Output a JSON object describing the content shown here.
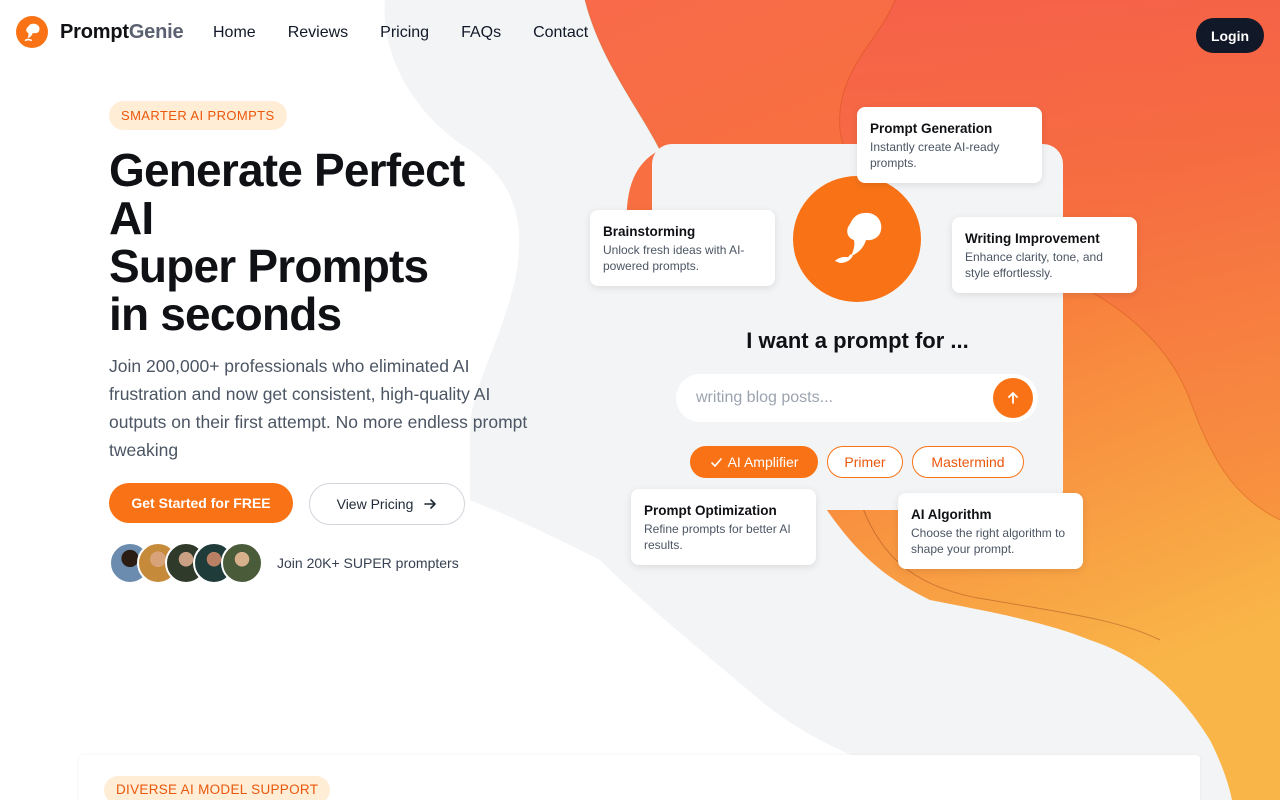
{
  "brand": {
    "name_part1": "Prompt",
    "name_part2": "Genie"
  },
  "nav": {
    "items": [
      "Home",
      "Reviews",
      "Pricing",
      "FAQs",
      "Contact"
    ]
  },
  "login_label": "Login",
  "hero": {
    "eyebrow": "SMARTER AI PROMPTS",
    "headline_lines": [
      "Generate Perfect",
      "AI",
      "Super Prompts",
      "in seconds"
    ],
    "subtitle": "Join 200,000+ professionals who eliminated AI frustration and now get consistent, high-quality AI outputs on their first attempt. No more endless prompt tweaking",
    "cta_primary": "Get Started for FREE",
    "cta_secondary": "View Pricing",
    "social_proof": "Join 20K+ SUPER prompters"
  },
  "prompt_card": {
    "question": "I want a prompt for ...",
    "input_placeholder": "writing blog posts...",
    "modes": [
      {
        "label": "AI Amplifier",
        "active": true
      },
      {
        "label": "Primer",
        "active": false
      },
      {
        "label": "Mastermind",
        "active": false
      }
    ]
  },
  "features": [
    {
      "title": "Prompt Generation",
      "desc": "Instantly create AI-ready prompts."
    },
    {
      "title": "Brainstorming",
      "desc": "Unlock fresh ideas with AI-powered prompts."
    },
    {
      "title": "Writing Improvement",
      "desc": "Enhance clarity, tone, and style effortlessly."
    },
    {
      "title": "Prompt Optimization",
      "desc": "Refine prompts for better AI results."
    },
    {
      "title": "AI Algorithm",
      "desc": "Choose the right algorithm to shape your prompt."
    }
  ],
  "section2": {
    "eyebrow": "DIVERSE AI MODEL SUPPORT"
  },
  "colors": {
    "accent": "#f97316",
    "accent_dark": "#ea580c",
    "dark": "#111827"
  },
  "icons": [
    "genie-logo-icon",
    "arrow-right-icon",
    "arrow-up-icon",
    "check-icon",
    "genie-lamp-icon"
  ]
}
